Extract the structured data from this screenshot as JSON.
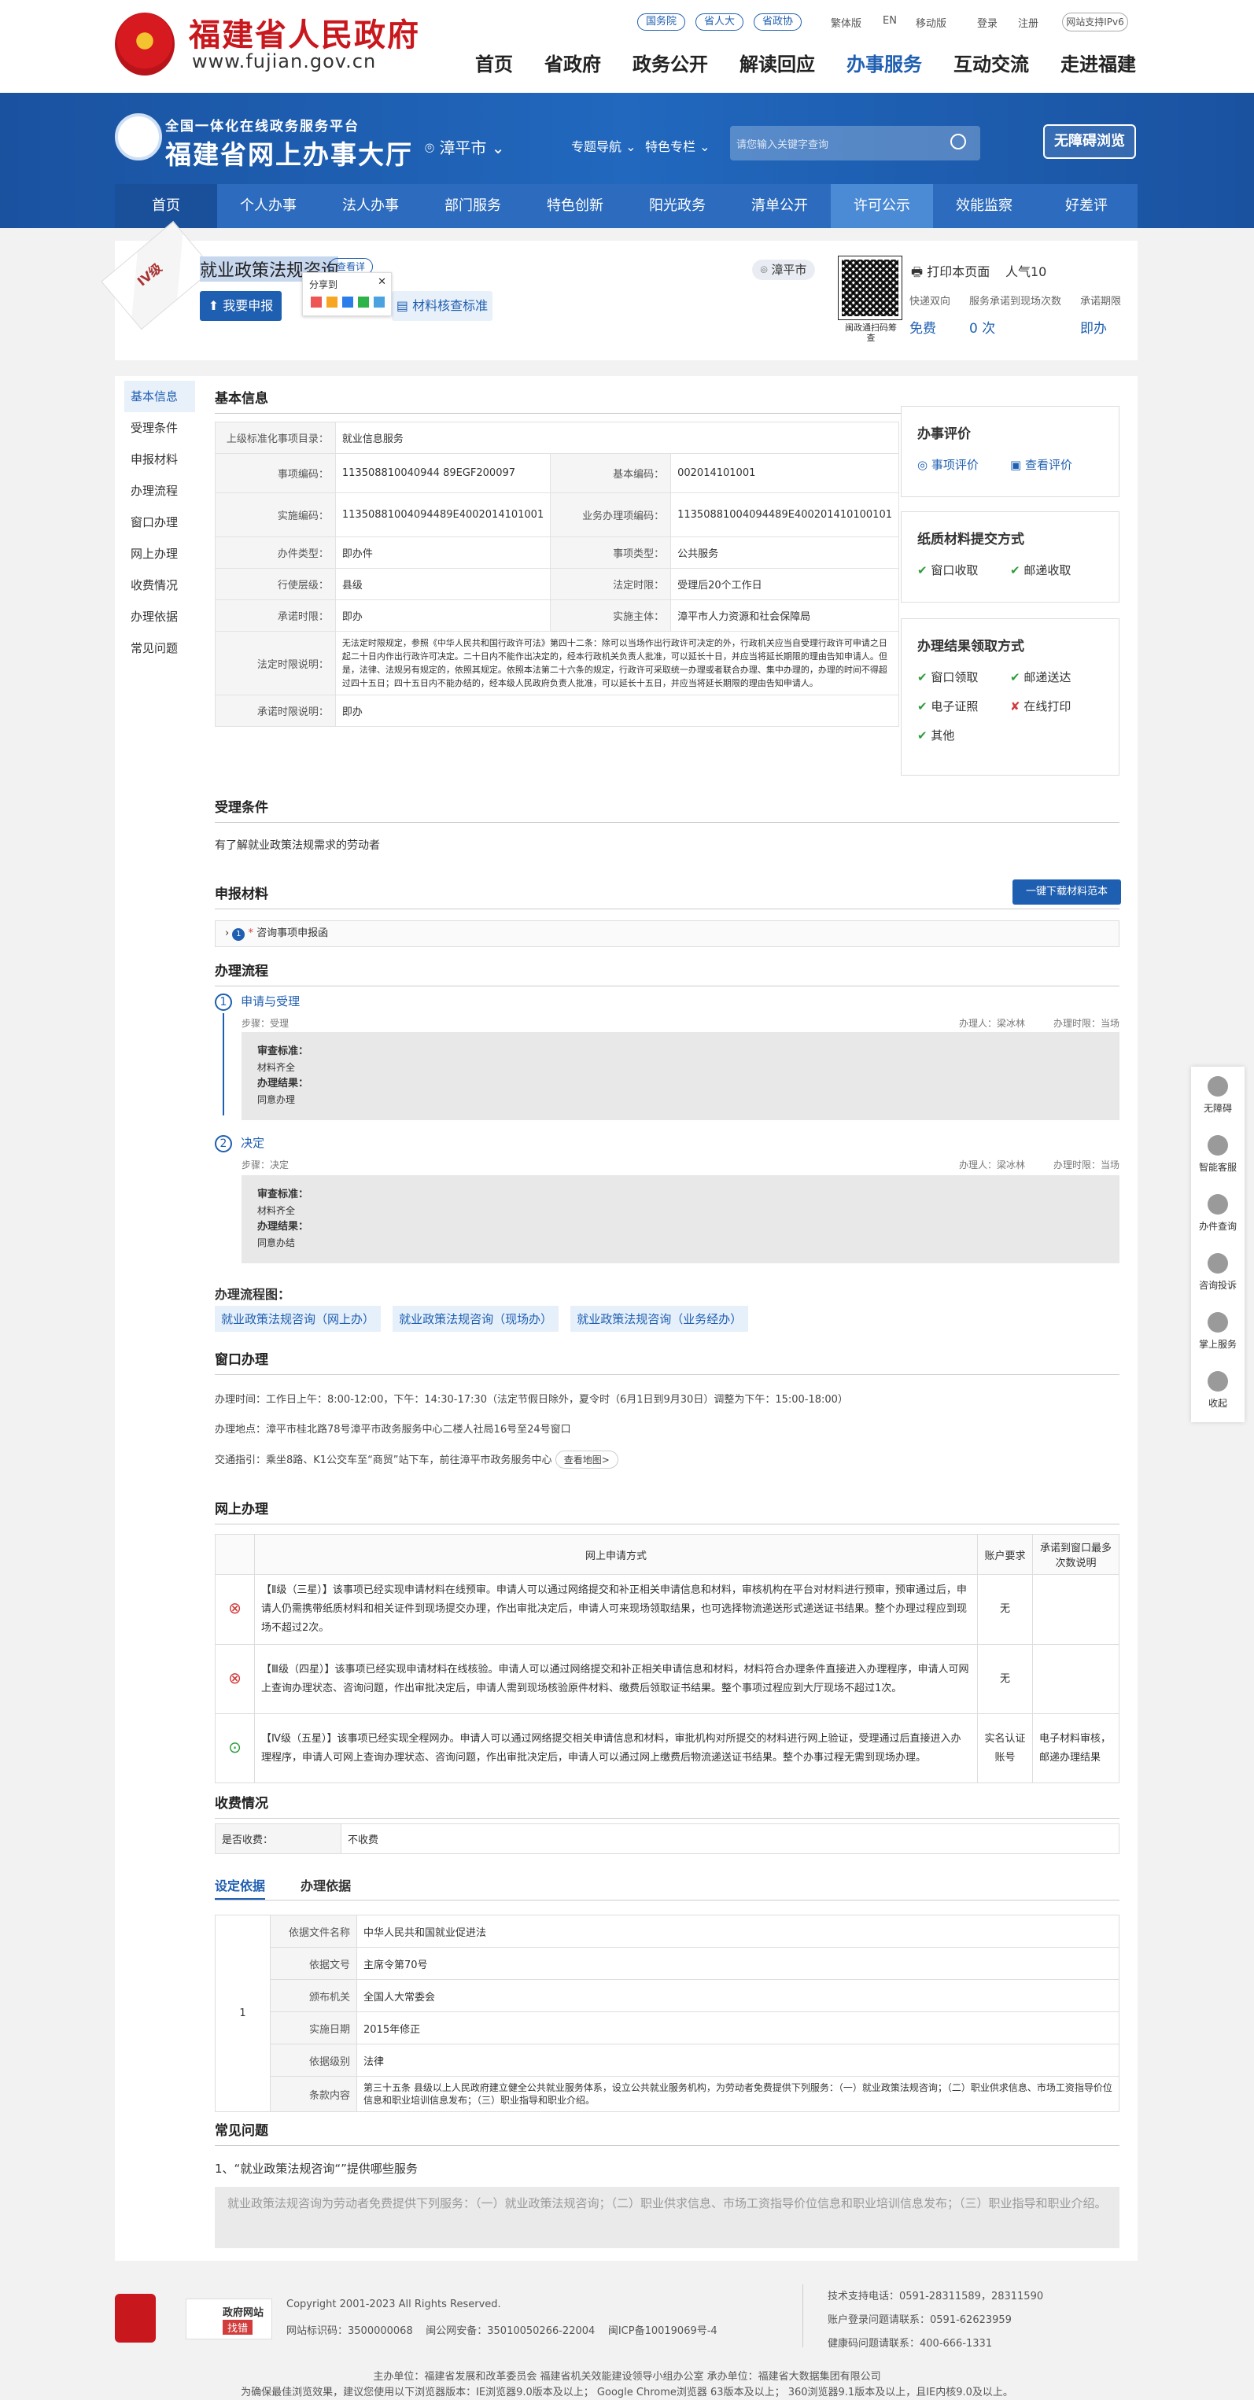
{
  "top": {
    "title": "福建省人民政府",
    "url": "www.fujian.gov.cn",
    "pills": [
      "国务院",
      "省人大",
      "省政协"
    ],
    "links": [
      "繁体版",
      "EN",
      "移动版",
      "登录",
      "注册"
    ],
    "ipv6": "网站支持IPv6",
    "nav": [
      "首页",
      "省政府",
      "政务公开",
      "解读回应",
      "办事服务",
      "互动交流",
      "走进福建"
    ]
  },
  "hall": {
    "sub": "全国一体化在线政务服务平台",
    "title": "福建省网上办事大厅",
    "city": "漳平市",
    "links": [
      "专题导航",
      "特色专栏"
    ],
    "search_placeholder": "请您输入关键字查询",
    "access": "无障碍浏览",
    "subnav": [
      "首页",
      "个人办事",
      "法人办事",
      "部门服务",
      "特色创新",
      "阳光政务",
      "清单公开",
      "许可公示",
      "效能监察",
      "好差评"
    ]
  },
  "item": {
    "level": "IV级",
    "title": "就业政策法规咨询",
    "badge": "查看详",
    "apply": "我要申报",
    "share_label": "分享到",
    "share_close": "✕",
    "standard": "材料核查标准",
    "location": "漳平市",
    "qr_text": "闽政通扫码筹查",
    "print": "打印本页面",
    "popularity": "人气10",
    "stats": [
      {
        "label": "快递双向",
        "value": "免费"
      },
      {
        "label": "服务承诺到现场次数",
        "value": "0 次"
      },
      {
        "label": "承诺期限",
        "value": "即办"
      }
    ]
  },
  "sidenav": [
    "基本信息",
    "受理条件",
    "申报材料",
    "办理流程",
    "窗口办理",
    "网上办理",
    "收费情况",
    "办理依据",
    "常见问题"
  ],
  "basic": {
    "heading": "基本信息",
    "rows": [
      {
        "k1": "上级标准化事项目录：",
        "v1": "就业信息服务",
        "k2": "",
        "v2": ""
      },
      {
        "k1": "事项编码：",
        "v1": "113508810040944 89EGF200097",
        "k2": "基本编码：",
        "v2": "002014101001"
      },
      {
        "k1": "实施编码：",
        "v1": "11350881004094489E4002014101001",
        "k2": "业务办理项编码：",
        "v2": "11350881004094489E400201410100101"
      },
      {
        "k1": "办件类型：",
        "v1": "即办件",
        "k2": "事项类型：",
        "v2": "公共服务"
      },
      {
        "k1": "行使层级：",
        "v1": "县级",
        "k2": "法定时限：",
        "v2": "受理后20个工作日"
      },
      {
        "k1": "承诺时限：",
        "v1": "即办",
        "k2": "实施主体：",
        "v2": "漳平市人力资源和社会保障局"
      },
      {
        "k1": "法定时限说明：",
        "v1": "无法定时限规定，参照《中华人民共和国行政许可法》第四十二条：除可以当场作出行政许可决定的外，行政机关应当自受理行政许可申请之日起二十日内作出行政许可决定。二十日内不能作出决定的，经本行政机关负责人批准，可以延长十日，并应当将延长期限的理由告知申请人。但是，法律、法规另有规定的，依照其规定。依照本法第二十六条的规定，行政许可采取统一办理或者联合办理、集中办理的，办理的时间不得超过四十五日；四十五日内不能办结的，经本级人民政府负责人批准，可以延长十五日，并应当将延长期限的理由告知申请人。",
        "k2": "",
        "v2": ""
      },
      {
        "k1": "承诺时限说明：",
        "v1": "即办",
        "k2": "",
        "v2": ""
      }
    ]
  },
  "eval": {
    "title": "办事评价",
    "items": [
      "事项评价",
      "查看评价"
    ]
  },
  "paper": {
    "title": "纸质材料提交方式",
    "items": [
      "窗口收取",
      "邮递收取"
    ]
  },
  "result": {
    "title": "办理结果领取方式",
    "items": [
      "窗口领取",
      "邮递送达",
      "电子证照",
      "在线打印",
      "其他"
    ]
  },
  "condition": {
    "heading": "受理条件",
    "text": "有了解就业政策法规需求的劳动者"
  },
  "materials": {
    "heading": "申报材料",
    "download": "一键下载材料范本",
    "row": "咨询事项申报函"
  },
  "process": {
    "heading": "办理流程",
    "steps": [
      {
        "no": "1",
        "title": "申请与受理",
        "step": "步骤：受理",
        "handler": "办理人：梁冰林",
        "time": "办理时限：当场",
        "std_label": "审查标准：",
        "std": "材料齐全",
        "res_label": "办理结果：",
        "res": "同意办理"
      },
      {
        "no": "2",
        "title": "决定",
        "step": "步骤：决定",
        "handler": "办理人：梁冰林",
        "time": "办理时限：当场",
        "std_label": "审查标准：",
        "std": "材料齐全",
        "res_label": "办理结果：",
        "res": "同意办结"
      }
    ],
    "chart_heading": "办理流程图：",
    "charts": [
      "就业政策法规咨询（网上办）",
      "就业政策法规咨询（现场办）",
      "就业政策法规咨询（业务经办）"
    ]
  },
  "window": {
    "heading": "窗口办理",
    "time": "办理时间：工作日上午：8:00-12:00，下午：14:30-17:30（法定节假日除外，夏令时（6月1日到9月30日）调整为下午：15:00-18:00）",
    "place": "办理地点：漳平市桂北路78号漳平市政务服务中心二楼人社局16号至24号窗口",
    "traffic": "交通指引：乘坐8路、K1公交车至“商贸”站下车，前往漳平市政务服务中心",
    "map": "查看地图>"
  },
  "online": {
    "heading": "网上办理",
    "cols": [
      "网上申请方式",
      "账户要求",
      "承诺到窗口最多次数说明"
    ],
    "rows": [
      {
        "status": "bad",
        "text": "【Ⅱ级（三星）】该事项已经实现申请材料在线预审。申请人可以通过网络提交和补正相关申请信息和材料，审核机构在平台对材料进行预审，预审通过后，申请人仍需携带纸质材料和相关证件到现场提交办理，作出审批决定后，申请人可来现场领取结果，也可选择物流递送形式递送证书结果。整个办理过程应到现场不超过2次。",
        "acct": "无",
        "note": ""
      },
      {
        "status": "bad",
        "text": "【Ⅲ级（四星）】该事项已经实现申请材料在线核验。申请人可以通过网络提交和补正相关申请信息和材料，材料符合办理条件直接进入办理程序，申请人可网上查询办理状态、咨询问题，作出审批决定后，申请人需到现场核验原件材料、缴费后领取证书结果。整个事项过程应到大厅现场不超过1次。",
        "acct": "无",
        "note": ""
      },
      {
        "status": "ok",
        "text": "【Ⅳ级（五星）】该事项已经实现全程网办。申请人可以通过网络提交相关申请信息和材料，审批机构对所提交的材料进行网上验证，受理通过后直接进入办理程序，申请人可网上查询办理状态、咨询问题，作出审批决定后，申请人可以通过网上缴费后物流递送证书结果。整个办事过程无需到现场办理。",
        "acct": "实名认证账号",
        "note": "电子材料审核，邮递办理结果"
      }
    ]
  },
  "fee": {
    "heading": "收费情况",
    "k": "是否收费：",
    "v": "不收费"
  },
  "basis": {
    "tabs": [
      "设定依据",
      "办理依据"
    ],
    "index": "1",
    "rows": [
      {
        "k": "依据文件名称",
        "v": "中华人民共和国就业促进法"
      },
      {
        "k": "依据文号",
        "v": "主席令第70号"
      },
      {
        "k": "颁布机关",
        "v": "全国人大常委会"
      },
      {
        "k": "实施日期",
        "v": "2015年修正"
      },
      {
        "k": "依据级别",
        "v": "法律"
      },
      {
        "k": "条款内容",
        "v": "第三十五条 县级以上人民政府建立健全公共就业服务体系，设立公共就业服务机构，为劳动者免费提供下列服务：（一）就业政策法规咨询；（二）职业供求信息、市场工资指导价位信息和职业培训信息发布；（三）职业指导和职业介绍。"
      }
    ]
  },
  "faq": {
    "heading": "常见问题",
    "q": "1、“就业政策法规咨询“”提供哪些服务",
    "a": "就业政策法规咨询为劳动者免费提供下列服务：（一）就业政策法规咨询；（二）职业供求信息、市场工资指导价位信息和职业培训信息发布；（三）职业指导和职业介绍。"
  },
  "rail": [
    "无障碍",
    "智能客服",
    "办件查询",
    "咨询投诉",
    "掌上服务",
    "收起"
  ],
  "footer": {
    "badge2a": "政府网站",
    "badge2b": "找错",
    "copyright": "Copyright 2001-2023 All Rights Reserved.",
    "id": "网站标识码：3500000068",
    "police": "闽公网安备：35010050266-22004",
    "icp": "闽ICP备10019069号-4",
    "support": "技术支持电话：0591-28311589，28311590",
    "account": "账户登录问题请联系：0591-62623959",
    "health": "健康码问题请联系：400-666-1331",
    "host": "主办单位：福建省发展和改革委员会    福建省机关效能建设领导小组办公室    承办单位：福建省大数据集团有限公司",
    "browser": "为确保最佳浏览效果，建议您使用以下浏览器版本：IE浏览器9.0版本及以上； Google Chrome浏览器 63版本及以上； 360浏览器9.1版本及以上，且IE内核9.0及以上。"
  }
}
